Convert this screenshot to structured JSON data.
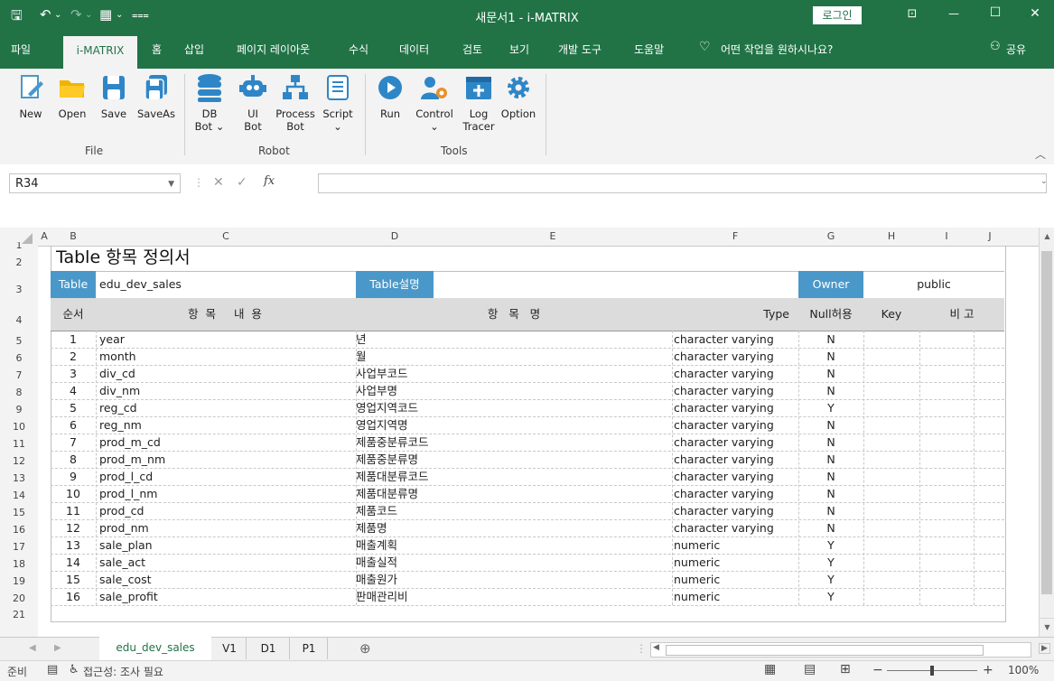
{
  "window": {
    "title": "새문서1  -  i-MATRIX",
    "login": "로그인",
    "minimize": "—",
    "maximize": "☐",
    "close": "✕",
    "layout_icon": "⊡"
  },
  "ribbon_tabs": [
    "파일",
    "i-MATRIX",
    "홈",
    "삽입",
    "페이지 레이아웃",
    "수식",
    "데이터",
    "검토",
    "보기",
    "개발 도구",
    "도움말"
  ],
  "tell_me": "어떤 작업을 원하시나요?",
  "share": "공유",
  "ribbon": {
    "file_group": "File",
    "robot_group": "Robot",
    "tools_group": "Tools",
    "new": "New",
    "open": "Open",
    "save": "Save",
    "saveas": "SaveAs",
    "db_bot": "DB",
    "db_bot2": "Bot ⌄",
    "ui_bot": "UI",
    "ui_bot2": "Bot",
    "process_bot": "Process",
    "process_bot2": "Bot",
    "script": "Script",
    "script2": "⌄",
    "run": "Run",
    "control": "Control",
    "control2": "⌄",
    "log_tracer": "Log",
    "log_tracer2": "Tracer",
    "option": "Option"
  },
  "namebox": "R34",
  "fx": "fx",
  "columns": [
    "A",
    "B",
    "C",
    "D",
    "E",
    "F",
    "G",
    "H",
    "I",
    "J"
  ],
  "sheet_title": "Table 항목 정의서",
  "header_row": {
    "table_label": "Table",
    "table_name": "edu_dev_sales",
    "table_desc_label": "Table설명",
    "owner_label": "Owner",
    "owner_value": "public"
  },
  "col_titles": {
    "seq": "순서",
    "item_content": "항 목   내 용",
    "item_name": "항   목   명",
    "type": "Type",
    "null": "Null허용",
    "key": "Key",
    "note": "비 고"
  },
  "row_numbers": [
    "1",
    "2",
    "3",
    "4",
    "5",
    "6",
    "7",
    "8",
    "9",
    "10",
    "11",
    "12",
    "13",
    "14",
    "15",
    "16",
    "17",
    "18",
    "19",
    "20",
    "21"
  ],
  "rows": [
    {
      "seq": "1",
      "name": "year",
      "kname": "년",
      "type": "character varying",
      "null": "N"
    },
    {
      "seq": "2",
      "name": "month",
      "kname": "월",
      "type": "character varying",
      "null": "N"
    },
    {
      "seq": "3",
      "name": "div_cd",
      "kname": "사업부코드",
      "type": "character varying",
      "null": "N"
    },
    {
      "seq": "4",
      "name": "div_nm",
      "kname": "사업부명",
      "type": "character varying",
      "null": "N"
    },
    {
      "seq": "5",
      "name": "reg_cd",
      "kname": "영업지역코드",
      "type": "character varying",
      "null": "Y"
    },
    {
      "seq": "6",
      "name": "reg_nm",
      "kname": "영업지역명",
      "type": "character varying",
      "null": "N"
    },
    {
      "seq": "7",
      "name": "prod_m_cd",
      "kname": "제품중분류코드",
      "type": "character varying",
      "null": "N"
    },
    {
      "seq": "8",
      "name": "prod_m_nm",
      "kname": "제품중분류명",
      "type": "character varying",
      "null": "N"
    },
    {
      "seq": "9",
      "name": "prod_l_cd",
      "kname": "제품대분류코드",
      "type": "character varying",
      "null": "N"
    },
    {
      "seq": "10",
      "name": "prod_l_nm",
      "kname": "제품대분류명",
      "type": "character varying",
      "null": "N"
    },
    {
      "seq": "11",
      "name": "prod_cd",
      "kname": "제품코드",
      "type": "character varying",
      "null": "N"
    },
    {
      "seq": "12",
      "name": "prod_nm",
      "kname": "제품명",
      "type": "character varying",
      "null": "N"
    },
    {
      "seq": "13",
      "name": "sale_plan",
      "kname": "매출계획",
      "type": "numeric",
      "null": "Y"
    },
    {
      "seq": "14",
      "name": "sale_act",
      "kname": "매출실적",
      "type": "numeric",
      "null": "Y"
    },
    {
      "seq": "15",
      "name": "sale_cost",
      "kname": "매출원가",
      "type": "numeric",
      "null": "Y"
    },
    {
      "seq": "16",
      "name": "sale_profit",
      "kname": "판매관리비",
      "type": "numeric",
      "null": "Y"
    }
  ],
  "sheet_tabs": [
    "edu_dev_sales",
    "V1",
    "D1",
    "P1"
  ],
  "status": {
    "ready": "준비",
    "accessibility": "접근성: 조사 필요",
    "zoom": "100%"
  },
  "colors": {
    "excel_green": "#217346",
    "header_blue": "#4a98c9",
    "header_gray": "#dcdcdc"
  }
}
